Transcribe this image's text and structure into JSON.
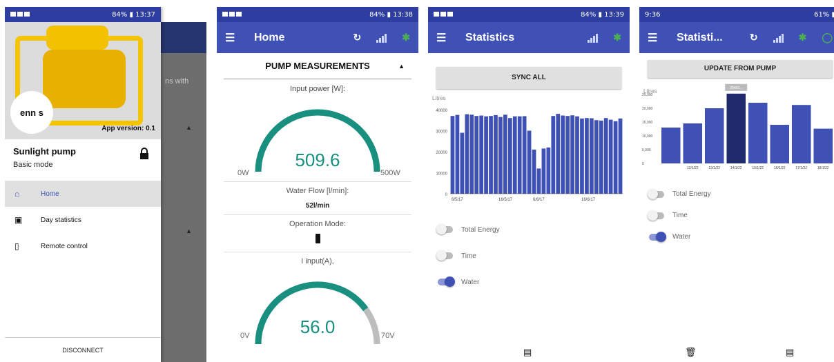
{
  "screen1": {
    "status": {
      "time": "13:37",
      "battery": "84%"
    },
    "drawer": {
      "logo_text": "enn s",
      "app_version": "App version: 0.1",
      "pump_name": "Sunlight pump",
      "mode": "Basic mode",
      "nav": [
        {
          "label": "Home",
          "icon": "home-icon",
          "active": true
        },
        {
          "label": "Day statistics",
          "icon": "calendar-icon",
          "active": false
        },
        {
          "label": "Remote control",
          "icon": "remote-icon",
          "active": false
        }
      ],
      "disconnect": "DISCONNECT"
    },
    "background_text": "ns with"
  },
  "screen2": {
    "status": {
      "time": "13:38",
      "battery": "84%"
    },
    "appbar_title": "Home",
    "section_title": "PUMP MEASUREMENTS",
    "input_power": {
      "label": "Input power [W]:",
      "value": "509.6",
      "min": "0W",
      "max": "500W",
      "fraction": 1.0
    },
    "water_flow": {
      "label": "Water Flow [l/min]:",
      "value": "52l/min"
    },
    "operation_mode": {
      "label": "Operation Mode:"
    },
    "i_input": {
      "label": "I input(A),",
      "value": "56.0",
      "min": "0V",
      "max": "70V",
      "fraction": 0.8
    },
    "colors": {
      "accent": "#19907f",
      "appbar": "#3f51b5"
    }
  },
  "screen3": {
    "status": {
      "time": "13:39",
      "battery": "84%"
    },
    "appbar_title": "Statistics",
    "button": "SYNC ALL",
    "chart_data": {
      "type": "bar",
      "ylabel": "Litres",
      "ylim": [
        0,
        40000
      ],
      "yticks": [
        "0",
        "10000",
        "20000",
        "30000",
        "40000"
      ],
      "xticks": [
        "6/5/17",
        "16/5/17",
        "6/6/17",
        "16/6/17"
      ],
      "values": [
        37000,
        37500,
        29000,
        37800,
        37600,
        37000,
        37200,
        36800,
        37000,
        37400,
        36500,
        37600,
        36000,
        36800,
        36800,
        36900,
        30000,
        21000,
        12000,
        21500,
        22000,
        37000,
        38000,
        37200,
        37000,
        37300,
        36800,
        35800,
        36000,
        35900,
        35000,
        34800,
        36000,
        35200,
        34500,
        35800
      ]
    },
    "toggles": [
      {
        "label": "Total Energy",
        "on": false
      },
      {
        "label": "Time",
        "on": false
      },
      {
        "label": "Water",
        "on": true
      }
    ]
  },
  "screen4": {
    "status": {
      "time": "9:36",
      "battery": "61%"
    },
    "appbar_title": "Statisti...",
    "button": "UPDATE FROM PUMP",
    "chart_data": {
      "type": "bar",
      "ylabel": "Litres",
      "ylim": [
        0,
        25000
      ],
      "yticks": [
        "0",
        "5,000",
        "10,000",
        "15,000",
        "20,000",
        "25,000"
      ],
      "categories": [
        "",
        "12/1/22",
        "13/1/22",
        "14/1/22",
        "15/1/22",
        "16/1/22",
        "17/1/22",
        "18/1/22"
      ],
      "values": [
        13000,
        14500,
        20000,
        25300,
        22000,
        14000,
        21200,
        12600
      ],
      "highlight_index": 3,
      "tooltip": "25460..."
    },
    "toggles": [
      {
        "label": "Total Energy",
        "on": false
      },
      {
        "label": "Time",
        "on": false
      },
      {
        "label": "Water",
        "on": true
      }
    ]
  }
}
